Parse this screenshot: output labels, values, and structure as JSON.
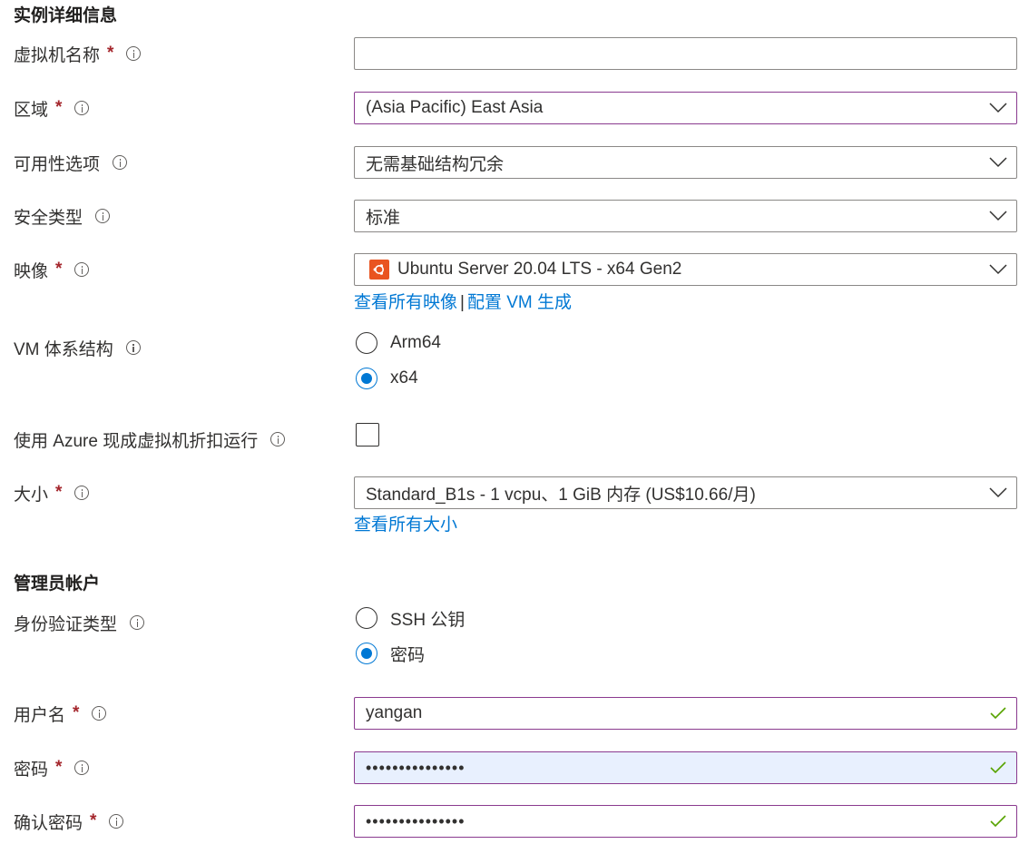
{
  "instance_details": {
    "title": "实例详细信息",
    "vm_name": {
      "label": "虚拟机名称",
      "required": "*",
      "value": ""
    },
    "region": {
      "label": "区域",
      "required": "*",
      "value": "(Asia Pacific) East Asia"
    },
    "availability": {
      "label": "可用性选项",
      "value": "无需基础结构冗余"
    },
    "security_type": {
      "label": "安全类型",
      "value": "标准"
    },
    "image": {
      "label": "映像",
      "required": "*",
      "value": "Ubuntu Server 20.04 LTS - x64 Gen2",
      "icon": "ubuntu-logo-icon",
      "link_all": "查看所有映像",
      "separator": "|",
      "link_config": "配置 VM 生成"
    },
    "vm_architecture": {
      "label": "VM 体系结构",
      "options": [
        {
          "label": "Arm64",
          "checked": false
        },
        {
          "label": "x64",
          "checked": true
        }
      ]
    },
    "azure_spot": {
      "label": "使用 Azure 现成虚拟机折扣运行",
      "checked": false
    },
    "size": {
      "label": "大小",
      "required": "*",
      "value": "Standard_B1s - 1 vcpu、1 GiB 内存 (US$10.66/月)",
      "link_all": "查看所有大小"
    }
  },
  "admin_account": {
    "title": "管理员帐户",
    "auth_type": {
      "label": "身份验证类型",
      "options": [
        {
          "label": "SSH 公钥",
          "checked": false
        },
        {
          "label": "密码",
          "checked": true
        }
      ]
    },
    "username": {
      "label": "用户名",
      "required": "*",
      "value": "yangan",
      "valid": true
    },
    "password": {
      "label": "密码",
      "required": "*",
      "value": "•••••••••••••••",
      "valid": true
    },
    "confirm_password": {
      "label": "确认密码",
      "required": "*",
      "value": "•••••••••••••••",
      "valid": true
    }
  },
  "colors": {
    "link": "#0078d4",
    "required": "#a4262c",
    "focus_border": "#8a3a8f",
    "radio_checked": "#0078d4",
    "valid_check": "#57a300",
    "ubuntu": "#e95420",
    "autofill_bg": "#e8f0fe"
  }
}
